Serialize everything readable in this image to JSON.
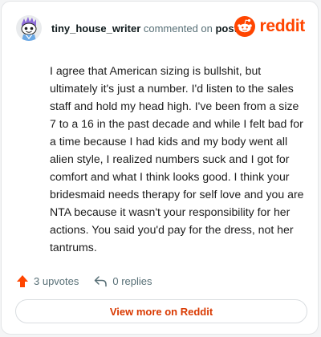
{
  "comment_header": {
    "username": "tiny_house_writer",
    "action_text": " commented on ",
    "post_link": "post"
  },
  "brand": {
    "wordmark": "reddit",
    "color": "#ff4500"
  },
  "comment": {
    "body": "I agree that American sizing is bullshit, but ultimately it's just a number. I'd listen to the sales staff and hold my head high. I've been from a size 7 to a 16 in the past decade and while I felt bad for a time because I had kids and my body went all alien style, I realized numbers suck and I got for comfort and what I think looks good. I think your bridesmaid needs therapy for self love and you are NTA because it wasn't your responsibility for her actions. You said you'd pay for the dress, not her tantrums."
  },
  "actions": {
    "upvotes_label": "3 upvotes",
    "replies_label": "0 replies",
    "upvote_icon": "arrow-up-icon",
    "reply_icon": "reply-icon"
  },
  "footer": {
    "view_more_label": "View more on Reddit",
    "accent_color": "#d93900"
  },
  "avatar": {
    "icon": "snoo-avatar-icon"
  }
}
